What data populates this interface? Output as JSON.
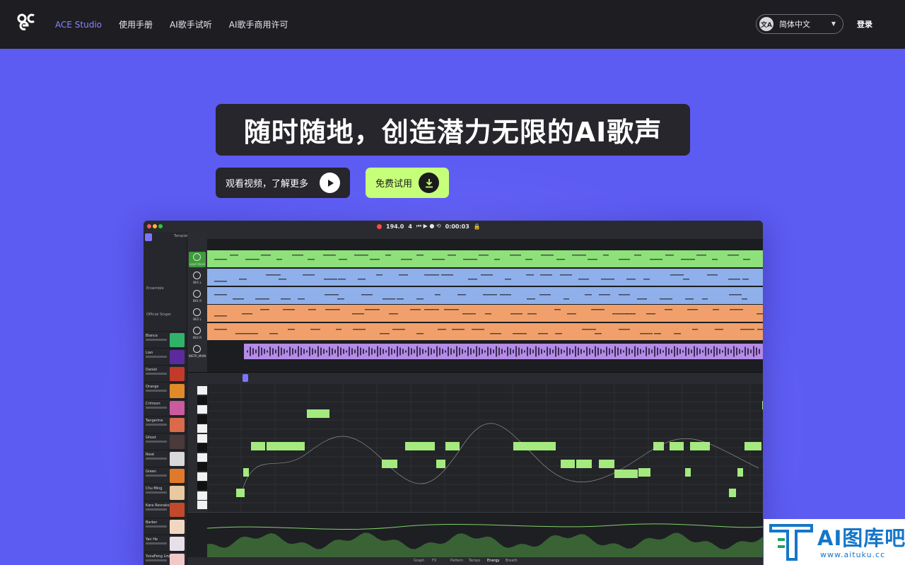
{
  "nav": {
    "links": [
      {
        "label": "ACE Studio",
        "active": true
      },
      {
        "label": "使用手册",
        "active": false
      },
      {
        "label": "AI歌手试听",
        "active": false
      },
      {
        "label": "AI歌手商用许可",
        "active": false
      }
    ],
    "language": "简体中文",
    "login": "登录"
  },
  "hero": {
    "headline": "随时随地，创造潜力无限的AI歌声",
    "video_button": "观看视频，了解更多",
    "trial_button": "免费试用"
  },
  "app": {
    "project_title": "Template Project",
    "tempo": "194.0",
    "beats": "4",
    "time": "0:00:03",
    "track_labels": [
      "Lead Vocal",
      "BV1 L",
      "BV1 R",
      "BV2 L",
      "BV2 R",
      "INSTR_MIXN"
    ],
    "sections": [
      "Ensemble",
      "Official Singer"
    ],
    "singers": [
      "Blanca",
      "Lian",
      "Daniel",
      "Orange",
      "Crimson",
      "Tangerine",
      "Ghost",
      "Rosé",
      "Green",
      "Chu Ming",
      "Kara Rosnaks",
      "Barker",
      "Yan He",
      "YunaFeng Ling",
      "Luo Tian Yi"
    ],
    "bottom_tabs": [
      "Graph",
      "FX",
      "Pattern",
      "Tempo",
      "Energy",
      "Breath"
    ],
    "colors": {
      "lead": "#8ee07a",
      "blue": "#8fb0ea",
      "orange": "#f1a06b",
      "purple": "#b48be6",
      "note": "#a4ea7e"
    }
  },
  "watermark": {
    "title": "AI图库吧",
    "url": "www.aituku.cc"
  }
}
